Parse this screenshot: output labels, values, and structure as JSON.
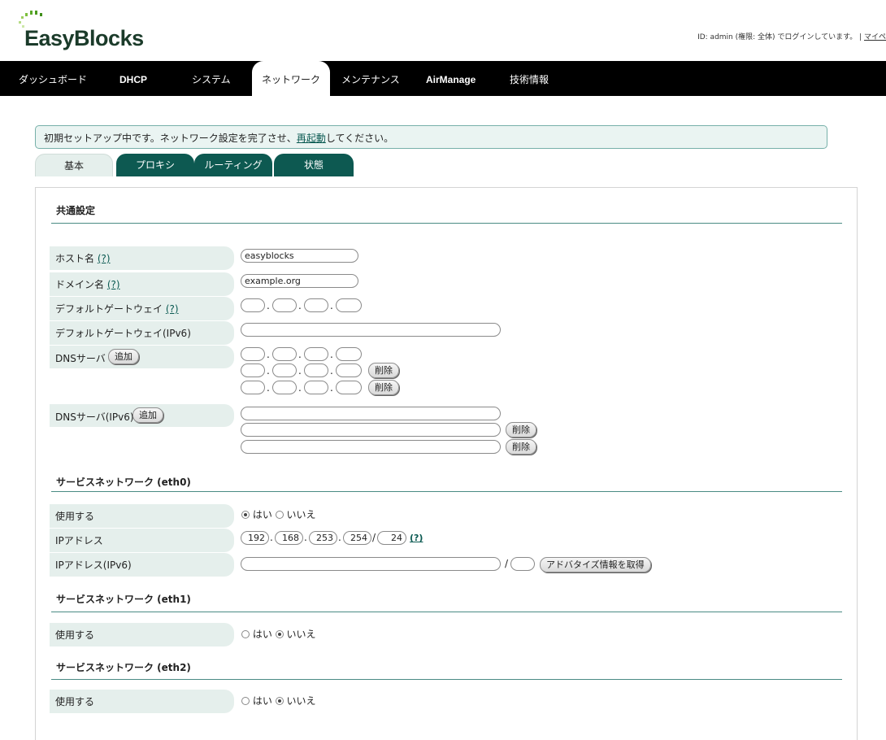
{
  "header": {
    "brand": "EasyBlocks",
    "login_text": "ID: admin (権限: 全体) でログインしています。 | ",
    "mypage_link": "マイペ"
  },
  "nav": [
    "ダッシュボード",
    "DHCP",
    "システム",
    "ネットワーク",
    "メンテナンス",
    "AirManage",
    "技術情報"
  ],
  "banner": {
    "before": "初期セットアップ中です。ネットワーク設定を完了させ、",
    "link": "再起動",
    "after": "してください。"
  },
  "subtabs": [
    "基本",
    "プロキシ",
    "ルーティング",
    "状態"
  ],
  "common": {
    "title": "共通設定",
    "help": "(?)",
    "hostname_label": "ホスト名",
    "hostname_value": "easyblocks",
    "domain_label": "ドメイン名",
    "domain_value": "example.org",
    "gateway_label": "デフォルトゲートウェイ",
    "gateway6_label": "デフォルトゲートウェイ(IPv6)",
    "dns_label": "DNSサーバ",
    "dns6_label": "DNSサーバ(IPv6)",
    "add": "追加",
    "delete": "削除"
  },
  "eth0": {
    "title": "サービスネットワーク (eth0)",
    "use_label": "使用する",
    "yes": "はい",
    "no": "いいえ",
    "ip_label": "IPアドレス",
    "ip": [
      "192",
      "168",
      "253",
      "254"
    ],
    "prefix": "24",
    "help": "(?)",
    "ip6_label": "IPアドレス(IPv6)",
    "fetch_button": "アドバタイズ情報を取得"
  },
  "eth1": {
    "title": "サービスネットワーク (eth1)",
    "use_label": "使用する",
    "yes": "はい",
    "no": "いいえ"
  },
  "eth2": {
    "title": "サービスネットワーク (eth2)",
    "use_label": "使用する",
    "yes": "はい",
    "no": "いいえ"
  },
  "colors": {
    "nav_bg": "#000000",
    "accent": "#0d5951",
    "label_bg": "#e5efec"
  }
}
